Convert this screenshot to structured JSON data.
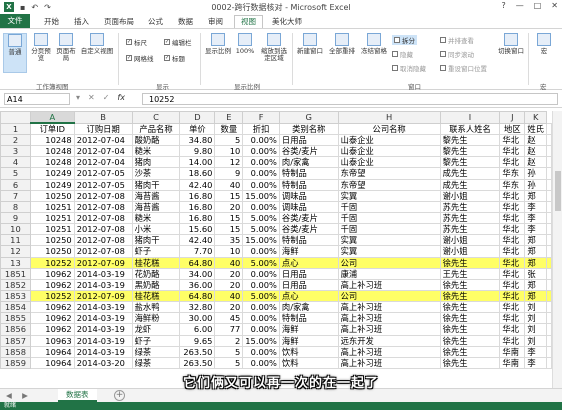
{
  "titlebar": {
    "title": "0002-跨行数据核对 - Microsoft Excel",
    "app_icon": "X",
    "win_controls": [
      "?",
      "—",
      "□",
      "✕"
    ]
  },
  "ribbon_tabs": [
    "文件",
    "开始",
    "插入",
    "页面布局",
    "公式",
    "数据",
    "审阅",
    "视图",
    "美化大师"
  ],
  "ribbon_active_tab": "视图",
  "ribbon": {
    "view_buttons": [
      "普通",
      "分页预览",
      "页面布局",
      "自定义视图"
    ],
    "view_group_label": "工作簿视图",
    "show_checks": [
      {
        "label": "标尺",
        "checked": true
      },
      {
        "label": "编辑栏",
        "checked": true
      },
      {
        "label": "网格线",
        "checked": true
      },
      {
        "label": "标题",
        "checked": true
      }
    ],
    "show_group_label": "显示",
    "zoom_buttons": [
      "显示比例",
      "100%",
      "缩放到选定区域"
    ],
    "zoom_group_label": "显示比例",
    "window_buttons": [
      "新建窗口",
      "全部重排",
      "冻结窗格"
    ],
    "window_small": [
      "拆分",
      "隐藏",
      "取消隐藏"
    ],
    "window_right_small": [
      "并排查看",
      "同步滚动",
      "重设窗口位置"
    ],
    "switch_window": "切换窗口",
    "macro": "宏",
    "window_group_label": "窗口",
    "macro_group_label": "宏"
  },
  "formula_bar": {
    "name_box": "A14",
    "fx_icons": [
      "▾",
      "✕",
      "✓",
      "fx"
    ],
    "value": "10252"
  },
  "columns": [
    "A",
    "B",
    "C",
    "D",
    "E",
    "F",
    "G",
    "H",
    "I",
    "J",
    "K"
  ],
  "rows": [
    {
      "n": "1",
      "cells": [
        "订单ID",
        "订购日期",
        "产品名称",
        "单价",
        "数量",
        "折扣",
        "类别名称",
        "公司名称",
        "联系人姓名",
        "地区",
        "姓氏"
      ],
      "header": true
    },
    {
      "n": "2",
      "cells": [
        "10248",
        "2012-07-04",
        "酸奶酪",
        "34.80",
        "5",
        "0.00%",
        "日用品",
        "山泰企业",
        "黎先生",
        "华北",
        "赵"
      ]
    },
    {
      "n": "3",
      "cells": [
        "10248",
        "2012-07-04",
        "糙米",
        "9.80",
        "10",
        "0.00%",
        "谷类/麦片",
        "山泰企业",
        "黎先生",
        "华北",
        "赵"
      ]
    },
    {
      "n": "4",
      "cells": [
        "10248",
        "2012-07-04",
        "猪肉",
        "14.00",
        "12",
        "0.00%",
        "肉/家禽",
        "山泰企业",
        "黎先生",
        "华北",
        "赵"
      ]
    },
    {
      "n": "5",
      "cells": [
        "10249",
        "2012-07-05",
        "沙茶",
        "18.60",
        "9",
        "0.00%",
        "特制品",
        "东帝望",
        "成先生",
        "华东",
        "孙"
      ]
    },
    {
      "n": "6",
      "cells": [
        "10249",
        "2012-07-05",
        "猪肉干",
        "42.40",
        "40",
        "0.00%",
        "特制品",
        "东帝望",
        "成先生",
        "华东",
        "孙"
      ]
    },
    {
      "n": "7",
      "cells": [
        "10250",
        "2012-07-08",
        "海苔酱",
        "16.80",
        "15",
        "15.00%",
        "调味品",
        "实翼",
        "谢小姐",
        "华北",
        "郑"
      ]
    },
    {
      "n": "8",
      "cells": [
        "10251",
        "2012-07-08",
        "海苔酱",
        "16.80",
        "20",
        "0.00%",
        "调味品",
        "千固",
        "苏先生",
        "华北",
        "李"
      ]
    },
    {
      "n": "9",
      "cells": [
        "10251",
        "2012-07-08",
        "糙米",
        "16.80",
        "15",
        "5.00%",
        "谷类/麦片",
        "千固",
        "苏先生",
        "华北",
        "李"
      ]
    },
    {
      "n": "10",
      "cells": [
        "10251",
        "2012-07-08",
        "小米",
        "15.60",
        "15",
        "5.00%",
        "谷类/麦片",
        "千固",
        "苏先生",
        "华北",
        "李"
      ]
    },
    {
      "n": "11",
      "cells": [
        "10250",
        "2012-07-08",
        "猪肉干",
        "42.40",
        "35",
        "15.00%",
        "特制品",
        "实翼",
        "谢小姐",
        "华北",
        "郑"
      ]
    },
    {
      "n": "12",
      "cells": [
        "10250",
        "2012-07-08",
        "虾子",
        "7.70",
        "10",
        "0.00%",
        "海鲜",
        "实翼",
        "谢小姐",
        "华北",
        "郑"
      ]
    },
    {
      "n": "13",
      "cells": [
        "10252",
        "2012-07-09",
        "桂花糕",
        "64.80",
        "40",
        "5.00%",
        "点心",
        "公司",
        "徐先生",
        "华北",
        "郑"
      ],
      "highlight": true
    },
    {
      "n": "1851",
      "cells": [
        "10962",
        "2014-03-19",
        "花奶酪",
        "34.00",
        "20",
        "0.00%",
        "日用品",
        "康浦",
        "王先生",
        "华北",
        "张"
      ]
    },
    {
      "n": "1852",
      "cells": [
        "10962",
        "2014-03-19",
        "黑奶酪",
        "36.00",
        "20",
        "0.00%",
        "日用品",
        "高上补习班",
        "徐先生",
        "华北",
        "郑"
      ]
    },
    {
      "n": "1853",
      "cells": [
        "10252",
        "2012-07-09",
        "桂花糕",
        "64.80",
        "40",
        "5.00%",
        "点心",
        "公司",
        "徐先生",
        "华北",
        "郑"
      ],
      "highlight": true
    },
    {
      "n": "1854",
      "cells": [
        "10962",
        "2014-03-19",
        "盐水鸭",
        "32.80",
        "20",
        "0.00%",
        "肉/家禽",
        "高上补习班",
        "徐先生",
        "华北",
        "刘"
      ]
    },
    {
      "n": "1855",
      "cells": [
        "10962",
        "2014-03-19",
        "海鲜粉",
        "30.00",
        "45",
        "0.00%",
        "特制品",
        "高上补习班",
        "徐先生",
        "华北",
        "刘"
      ]
    },
    {
      "n": "1856",
      "cells": [
        "10962",
        "2014-03-19",
        "龙虾",
        "6.00",
        "77",
        "0.00%",
        "海鲜",
        "高上补习班",
        "徐先生",
        "华北",
        "刘"
      ]
    },
    {
      "n": "1857",
      "cells": [
        "10963",
        "2014-03-19",
        "虾子",
        "9.65",
        "2",
        "15.00%",
        "海鲜",
        "远东开发",
        "徐先生",
        "华北",
        "刘"
      ]
    },
    {
      "n": "1858",
      "cells": [
        "10964",
        "2014-03-19",
        "绿茶",
        "263.50",
        "5",
        "0.00%",
        "饮料",
        "高上补习班",
        "徐先生",
        "华南",
        "李"
      ]
    },
    {
      "n": "1859",
      "cells": [
        "10964",
        "2014-03-20",
        "绿茶",
        "263.50",
        "5",
        "0.00%",
        "饮料",
        "高上补习班",
        "徐先生",
        "华南",
        "李"
      ]
    }
  ],
  "sheet_tabs": {
    "nav": "◀ ▶",
    "active": "数据表",
    "add": "+"
  },
  "status": "就绪",
  "subtitle": "它们俩又可以再一次的在一起了"
}
